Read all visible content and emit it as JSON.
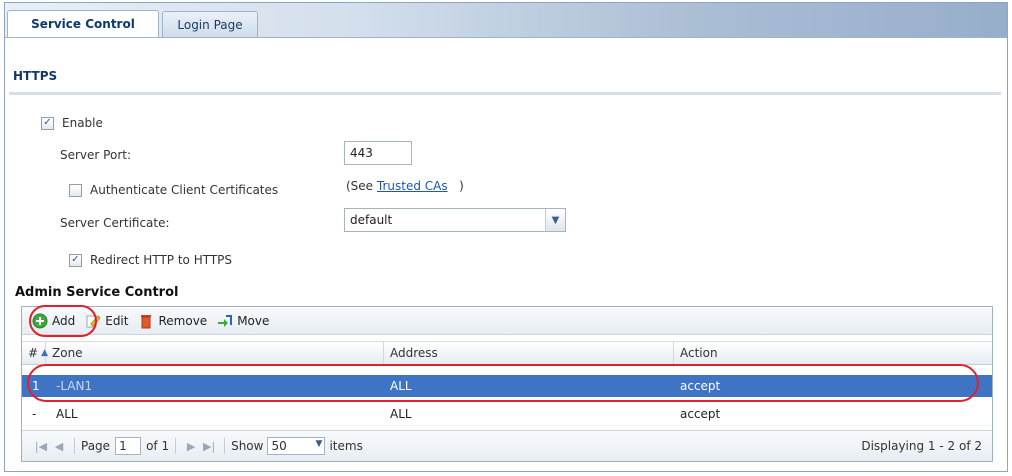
{
  "tabs": [
    {
      "label": "Service Control",
      "active": true
    },
    {
      "label": "Login Page",
      "active": false
    }
  ],
  "https": {
    "section_title": "HTTPS",
    "enable_label": "Enable",
    "enable_checked": true,
    "server_port_label": "Server Port:",
    "server_port_value": "443",
    "auth_client_label": "Authenticate Client Certificates",
    "auth_client_checked": false,
    "see_prefix": "(See",
    "trusted_cas_link": "Trusted CAs",
    "see_suffix": ")",
    "server_cert_label": "Server Certificate:",
    "server_cert_value": "default",
    "redirect_label": "Redirect HTTP to HTTPS",
    "redirect_checked": true
  },
  "admin": {
    "section_title": "Admin Service Control",
    "toolbar": {
      "add": "Add",
      "edit": "Edit",
      "remove": "Remove",
      "move": "Move"
    },
    "columns": {
      "num": "#",
      "zone": "Zone",
      "address": "Address",
      "action": "Action"
    },
    "rows": [
      {
        "num": "1",
        "zone": "LAN1",
        "address": "ALL",
        "action": "accept",
        "selected": true
      },
      {
        "num": "-",
        "zone": "ALL",
        "address": "ALL",
        "action": "accept",
        "selected": false
      }
    ],
    "pager": {
      "page_label": "Page",
      "page_value": "1",
      "of_label": "of 1",
      "show_label": "Show",
      "show_value": "50",
      "items_label": "items",
      "displaying": "Displaying 1 - 2 of 2"
    }
  },
  "colors": {
    "selected_row": "#3f74c5",
    "annotation": "#e0202a",
    "section_title": "#12386a"
  }
}
